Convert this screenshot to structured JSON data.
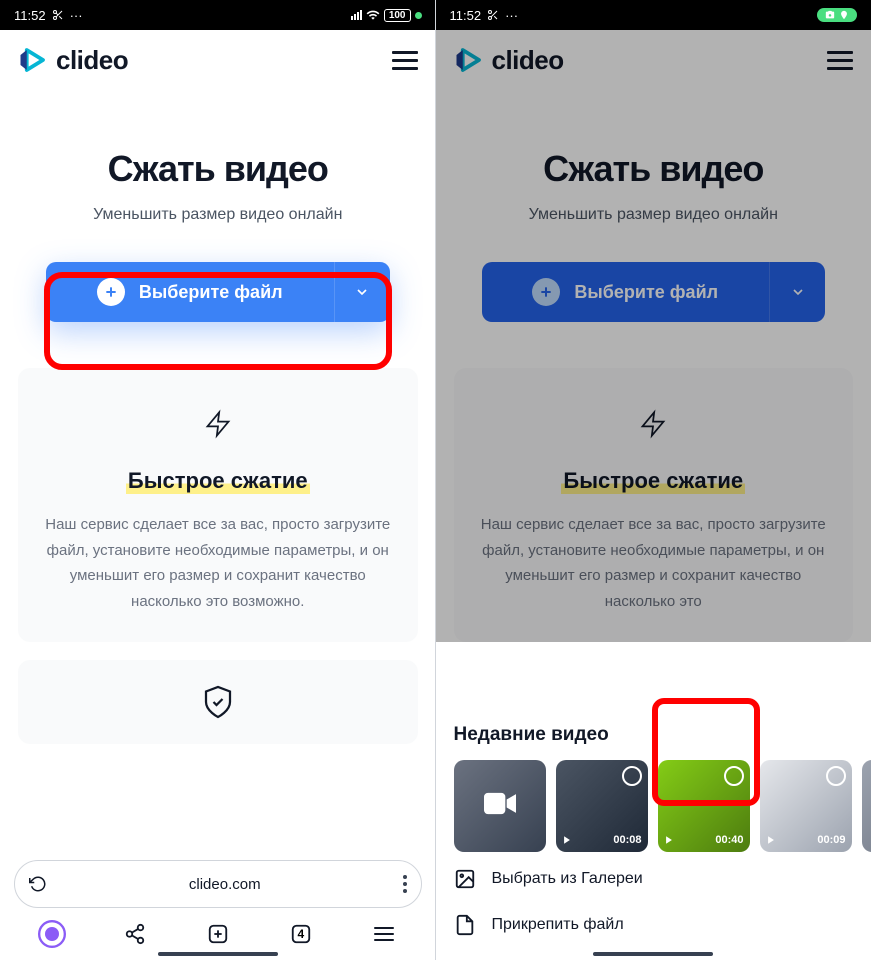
{
  "status": {
    "time": "11:52"
  },
  "header": {
    "brand": "clideo"
  },
  "hero": {
    "title": "Сжать видео",
    "subtitle": "Уменьшить размер видео онлайн"
  },
  "choose": {
    "label": "Выберите файл"
  },
  "card": {
    "title": "Быстрое сжатие",
    "text": "Наш сервис сделает все за вас, просто загрузите файл, установите необходимые параметры, и он уменьшит его размер и сохранит качество насколько это возможно."
  },
  "card2_text": "Наш сервис сделает все за вас, просто загрузите файл, установите необходимые параметры, и он уменьшит его размер и сохранит качество насколько это",
  "browser": {
    "url": "clideo.com",
    "tabs": "4"
  },
  "sheet": {
    "title": "Недавние видео",
    "thumbs": [
      {
        "duration": ""
      },
      {
        "duration": "00:08"
      },
      {
        "duration": "00:40"
      },
      {
        "duration": "00:09"
      },
      {
        "duration": ""
      }
    ],
    "gallery": "Выбрать из Галереи",
    "attach": "Прикрепить файл"
  }
}
